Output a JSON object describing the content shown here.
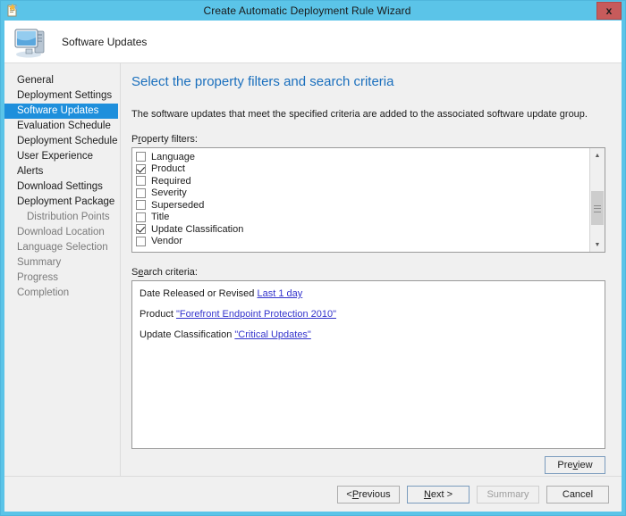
{
  "window": {
    "title": "Create Automatic Deployment Rule Wizard",
    "close_label": "x",
    "title_icon": "wizard-document-icon",
    "frame_color": "#5bc4e8"
  },
  "banner": {
    "title": "Software Updates",
    "icon": "computer-monitor-icon"
  },
  "sidebar": {
    "items": [
      {
        "label": "General",
        "state": "normal"
      },
      {
        "label": "Deployment Settings",
        "state": "normal"
      },
      {
        "label": "Software Updates",
        "state": "selected"
      },
      {
        "label": "Evaluation Schedule",
        "state": "normal"
      },
      {
        "label": "Deployment Schedule",
        "state": "normal"
      },
      {
        "label": "User Experience",
        "state": "normal"
      },
      {
        "label": "Alerts",
        "state": "normal"
      },
      {
        "label": "Download Settings",
        "state": "normal"
      },
      {
        "label": "Deployment Package",
        "state": "normal"
      },
      {
        "label": "Distribution Points",
        "state": "sub-dim"
      },
      {
        "label": "Download Location",
        "state": "dim"
      },
      {
        "label": "Language Selection",
        "state": "dim"
      },
      {
        "label": "Summary",
        "state": "dim"
      },
      {
        "label": "Progress",
        "state": "dim"
      },
      {
        "label": "Completion",
        "state": "dim"
      }
    ],
    "selected_color": "#1e8fdc"
  },
  "content": {
    "heading": "Select the property filters and search criteria",
    "heading_color": "#1a6fbd",
    "description": "The software updates that meet the specified criteria are added to the associated software update group.",
    "property_filters_label_pre": "P",
    "property_filters_label_acc": "r",
    "property_filters_label_post": "operty filters:",
    "search_criteria_label_pre": "S",
    "search_criteria_label_acc": "e",
    "search_criteria_label_post": "arch criteria:",
    "filters": [
      {
        "label": "Language",
        "checked": false
      },
      {
        "label": "Product",
        "checked": true
      },
      {
        "label": "Required",
        "checked": false
      },
      {
        "label": "Severity",
        "checked": false
      },
      {
        "label": "Superseded",
        "checked": false
      },
      {
        "label": "Title",
        "checked": false
      },
      {
        "label": "Update Classification",
        "checked": true
      },
      {
        "label": "Vendor",
        "checked": false
      }
    ],
    "scrollbar": {
      "up_arrow": "▲",
      "down_arrow": "▼"
    },
    "criteria": [
      {
        "text": "Date Released or Revised ",
        "link": "Last 1 day"
      },
      {
        "text": "Product ",
        "link": "\"Forefront Endpoint Protection 2010\""
      },
      {
        "text": "Update Classification ",
        "link": "\"Critical Updates\""
      }
    ],
    "link_color": "#3333cc"
  },
  "buttons": {
    "preview_pre": "Pre",
    "preview_acc": "v",
    "preview_post": "iew",
    "previous_pre": "< ",
    "previous_acc": "P",
    "previous_post": "revious",
    "next_pre": "",
    "next_acc": "N",
    "next_post": "ext >",
    "summary": "Summary",
    "cancel": "Cancel"
  }
}
